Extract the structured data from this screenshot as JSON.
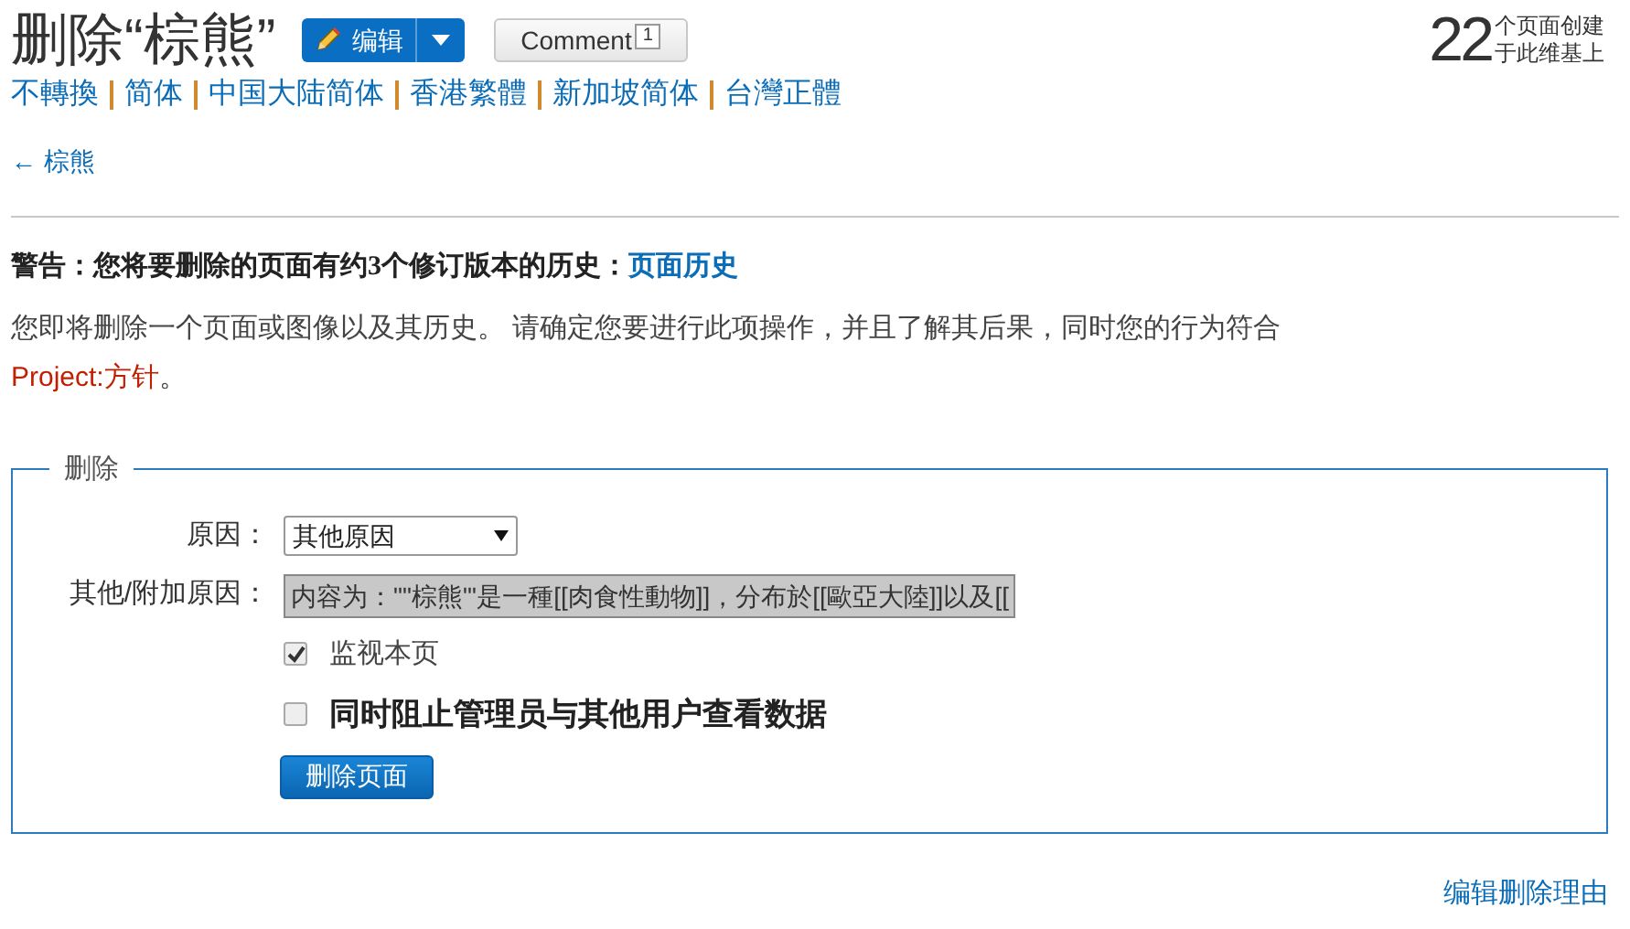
{
  "title": "删除“棕熊”",
  "edit_button": {
    "label": "编辑"
  },
  "comment_button": {
    "label": "Comment",
    "count": "1"
  },
  "page_count": {
    "number": "22",
    "line_1": "个页面创建",
    "line_2": "于此维基上"
  },
  "variants": [
    {
      "label": "不轉換"
    },
    {
      "label": "简体"
    },
    {
      "label": "中国大陆简体"
    },
    {
      "label": "香港繁體"
    },
    {
      "label": "新加坡简体"
    },
    {
      "label": "台灣正體"
    }
  ],
  "back_link": "← 棕熊",
  "warning": {
    "text": "警告：您将要删除的页面有约3个修订版本的历史：",
    "link": "页面历史"
  },
  "notice": {
    "text": "您即将删除一个页面或图像以及其历史。 请确定您要进行此项操作，并且了解其后果，同时您的行为符合",
    "link_prefix": "Project:",
    "link": "方针",
    "end": "。"
  },
  "form": {
    "legend": "删除",
    "reason_label": "原因：",
    "reason_value": "其他原因",
    "other_label": "其他/附加原因：",
    "other_value": "内容为：\"\"棕熊\"'是一種[[肉食性動物]]，分布於[[歐亞大陸]]以及[[",
    "options": [
      {
        "label": "监视本页",
        "checked": true,
        "bold": false
      },
      {
        "label": "同时阻止管理员与其他用户查看数据",
        "checked": false,
        "bold": true
      }
    ],
    "submit": "删除页面"
  },
  "edit_reasons_link": "编辑删除理由"
}
